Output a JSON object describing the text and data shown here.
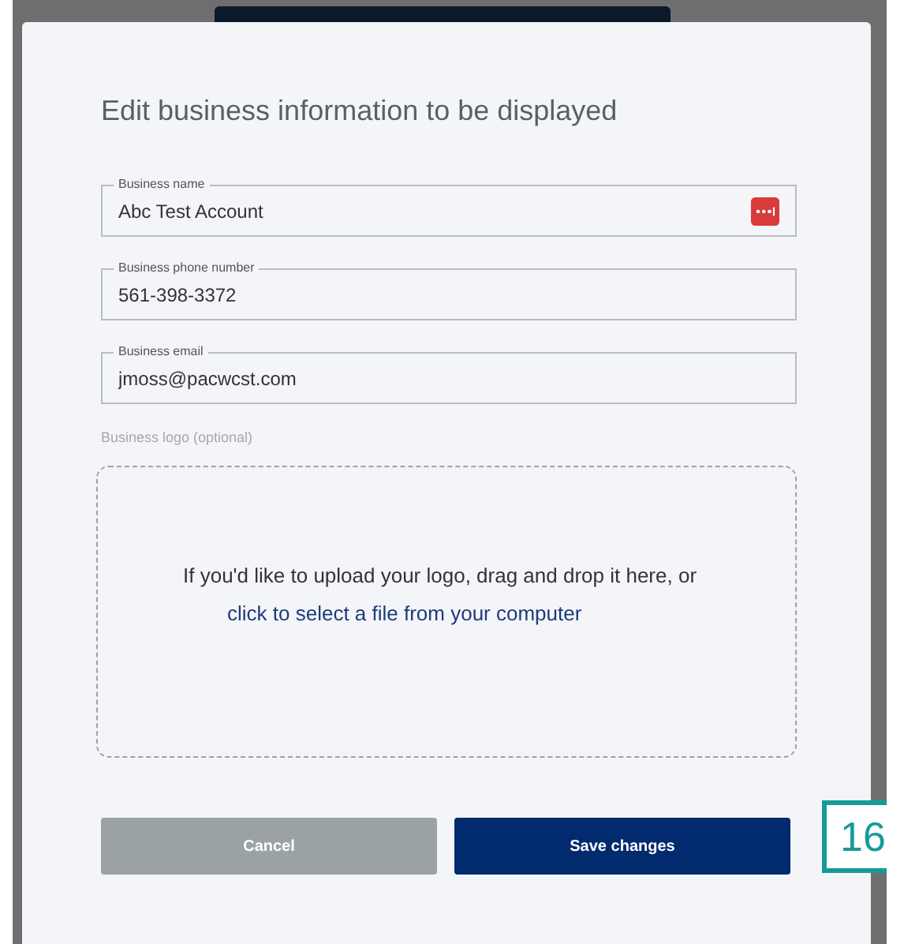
{
  "dialog": {
    "title": "Edit business information to be displayed",
    "fields": [
      {
        "label": "Business name",
        "value": "Abc Test Account",
        "password_manager_icon": true
      },
      {
        "label": "Business phone number",
        "value": "561-398-3372",
        "password_manager_icon": false
      },
      {
        "label": "Business email",
        "value": "jmoss@pacwcst.com",
        "password_manager_icon": false
      }
    ],
    "logo_label": "Business logo (optional)",
    "dropzone": {
      "text": "If you'd like to upload your logo, drag and drop it here, or",
      "link": "click to select a file from your computer"
    },
    "buttons": [
      {
        "label": "Cancel",
        "kind": "secondary"
      },
      {
        "label": "Save changes",
        "kind": "primary"
      }
    ]
  },
  "step_badge": "16"
}
